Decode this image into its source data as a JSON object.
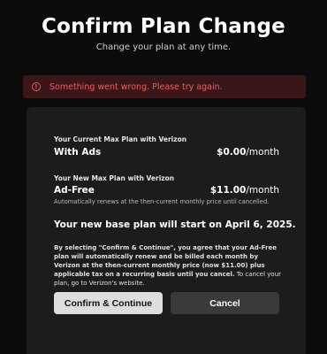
{
  "header": {
    "title": "Confirm Plan Change",
    "subtitle": "Change your plan at any time."
  },
  "error": {
    "icon": "error-circle-icon",
    "message": "Something went wrong. Please try again.",
    "color": "#ee5c63"
  },
  "current_plan": {
    "label": "Your Current Max Plan with Verizon",
    "name": "With Ads",
    "price": "$0.00",
    "period": "/month"
  },
  "new_plan": {
    "label": "Your New Max Plan with Verizon",
    "name": "Ad-Free",
    "price": "$11.00",
    "period": "/month",
    "note": "Automatically renews at the then-current monthly price until cancelled."
  },
  "start_text": "Your new base plan will start on April 6, 2025.",
  "terms": {
    "bold_part": "By selecting \"Confirm & Continue\", you agree that your Ad-Free plan will automatically renew and be billed each month by Verizon at the then-current monthly price (now $11.00) plus applicable tax on a recurring basis until you cancel.",
    "rest": " To cancel your plan, go to Verizon's website."
  },
  "buttons": {
    "confirm_label": "Confirm & Continue",
    "cancel_label": "Cancel"
  }
}
